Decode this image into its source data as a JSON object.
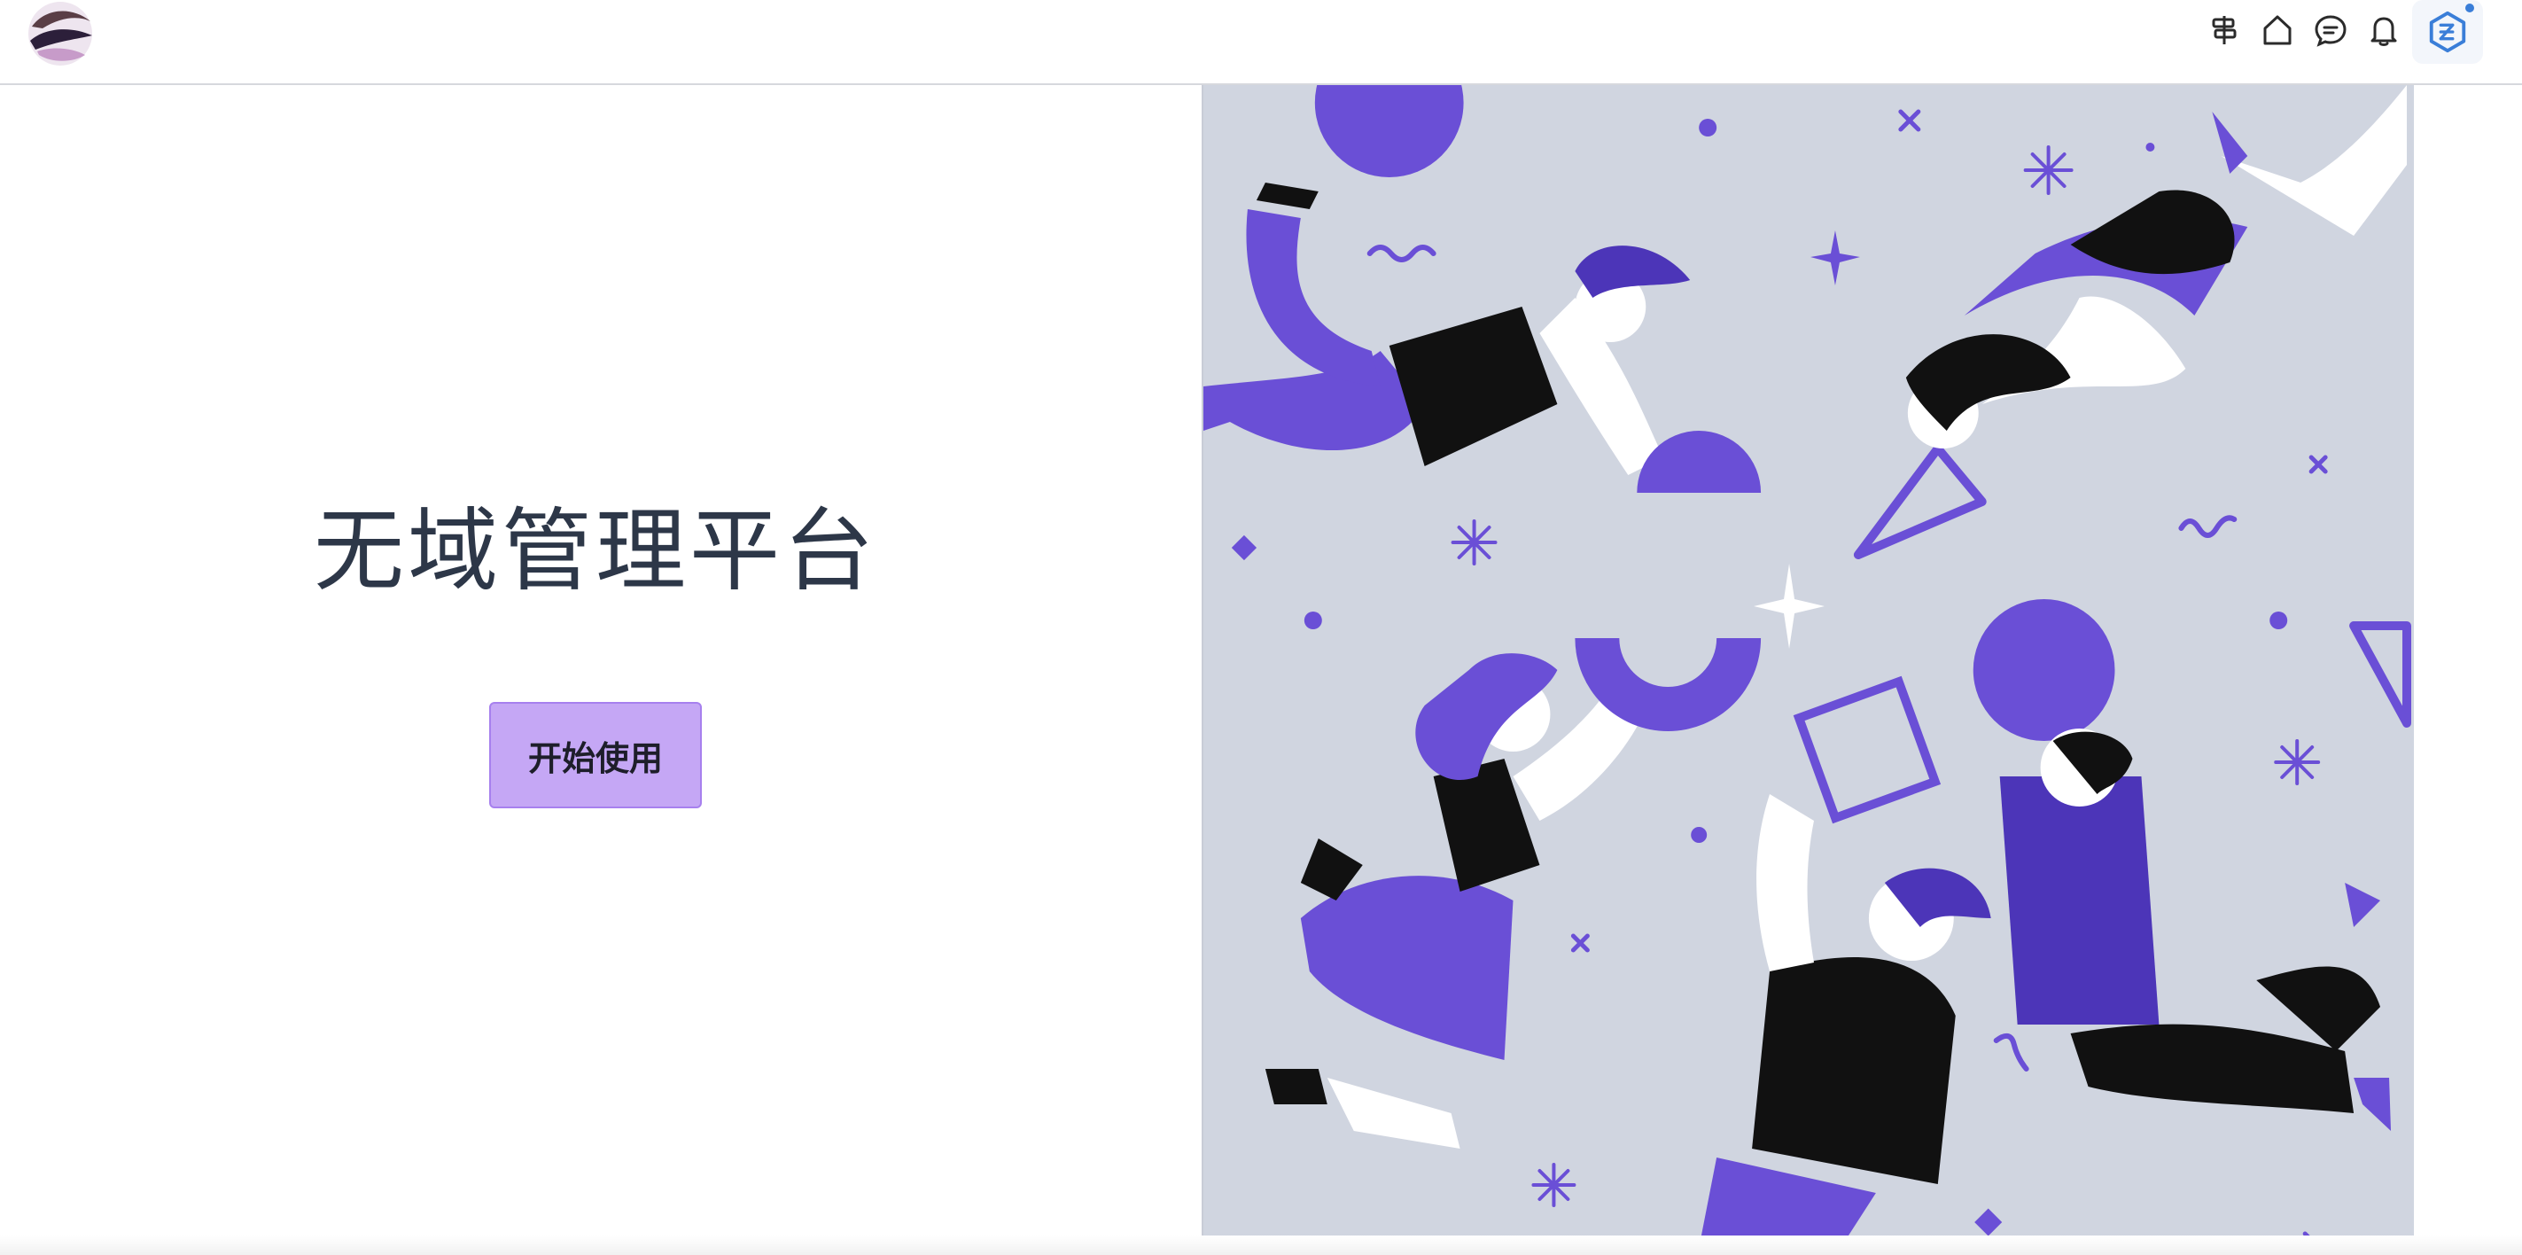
{
  "app": {
    "title": "无域管理平台",
    "start_button_label": "开始使用"
  },
  "header": {
    "logo_icon": "brand-swirl-logo",
    "actions": [
      {
        "name": "api-signpost-icon",
        "label": ""
      },
      {
        "name": "home-icon",
        "label": ""
      },
      {
        "name": "message-icon",
        "label": ""
      },
      {
        "name": "notification-bell-icon",
        "label": ""
      }
    ],
    "avatar_icon": "user-avatar-logo"
  },
  "colors": {
    "accent_purple": "#6a4fd6",
    "button_bg": "#c5a7f5",
    "illustration_bg": "#d0d5e0",
    "title_text": "#2d3748",
    "avatar_blue": "#3a7ed8"
  },
  "illustration": {
    "name": "people-floating-with-shapes-illustration"
  }
}
